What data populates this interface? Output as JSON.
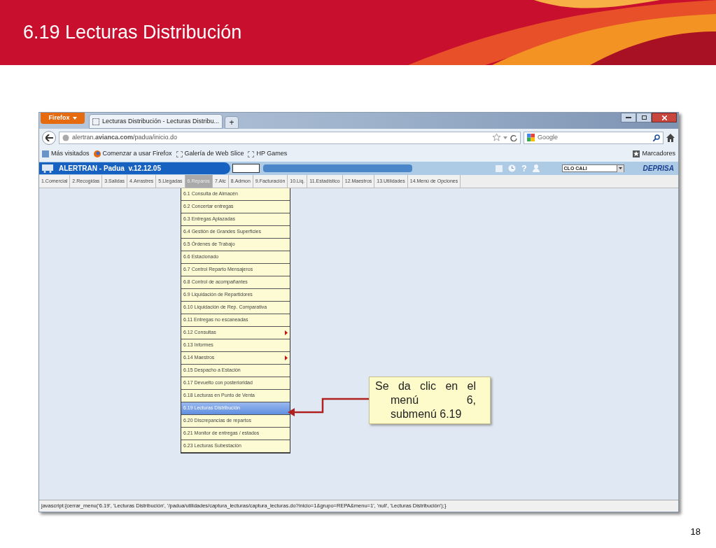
{
  "slide": {
    "title": "6.19 Lecturas Distribución",
    "page_number": "18"
  },
  "browser": {
    "firefox_button": "Firefox",
    "tab_title": "Lecturas Distribución - Lecturas Distribu...",
    "new_tab": "+",
    "url": "alertran.**avianca.com**/padua/inicio.do",
    "search_placeholder": "Google",
    "bookmarks": [
      "Más visitados",
      "Comenzar a usar Firefox",
      "Galería de Web Slice",
      "HP Games"
    ],
    "bookmarks_menu": "Marcadores"
  },
  "app": {
    "title": "ALERTRAN - Padua  v.12.12.05",
    "help": "?",
    "office": "CLO CALI",
    "logo": "DEPRISA"
  },
  "menu_tabs": [
    {
      "label": "1.Comercial",
      "selected": false
    },
    {
      "label": "2.Recogidas",
      "selected": false
    },
    {
      "label": "3.Salidas",
      "selected": false
    },
    {
      "label": "4.Arrastres",
      "selected": false
    },
    {
      "label": "5.Llegadas",
      "selected": false
    },
    {
      "label": "6.Reparos",
      "selected": true
    },
    {
      "label": "7.Atc",
      "selected": false
    },
    {
      "label": "8.Admon",
      "selected": false
    },
    {
      "label": "9.Facturación",
      "selected": false
    },
    {
      "label": "10.Liq.",
      "selected": false
    },
    {
      "label": "11.Estadístico",
      "selected": false
    },
    {
      "label": "12.Maestros",
      "selected": false
    },
    {
      "label": "13.Utilidades",
      "selected": false
    },
    {
      "label": "14.Menú de Opciones",
      "selected": false
    }
  ],
  "submenu": [
    {
      "label": "6.1 Consulta de Almacén",
      "kind": "item",
      "selected": false
    },
    {
      "label": "6.2 Concertar entregas",
      "kind": "item",
      "selected": false
    },
    {
      "label": "6.3 Entregas Aplazadas",
      "kind": "item",
      "selected": false
    },
    {
      "label": "6.4 Gestión de Grandes Superficies",
      "kind": "item",
      "selected": false
    },
    {
      "label": "6.5 Órdenes de Trabajo",
      "kind": "item",
      "selected": false
    },
    {
      "label": "6.6 Estacionado",
      "kind": "item",
      "selected": false
    },
    {
      "label": "6.7 Control Reparto Mensajeros",
      "kind": "item",
      "selected": false
    },
    {
      "label": "6.8 Control de acompañantes",
      "kind": "item",
      "selected": false
    },
    {
      "label": "6.9 Liquidación de Repartidores",
      "kind": "item",
      "selected": false
    },
    {
      "label": "6.10 Liquidación de Rep. Comparativa",
      "kind": "item",
      "selected": false
    },
    {
      "label": "6.11 Entregas no escaneadas",
      "kind": "item",
      "selected": false
    },
    {
      "label": "6.12 Consultas",
      "kind": "submenu",
      "selected": false
    },
    {
      "label": "6.13 Informes",
      "kind": "item",
      "selected": false
    },
    {
      "label": "6.14 Maestros",
      "kind": "submenu",
      "selected": false
    },
    {
      "label": "6.15 Despacho a Estación",
      "kind": "item",
      "selected": false
    },
    {
      "label": "6.17 Devuelto con posterioridad",
      "kind": "item",
      "selected": false
    },
    {
      "label": "6.18 Lecturas en Punto de Venta",
      "kind": "item",
      "selected": false
    },
    {
      "label": "6.19 Lecturas Distribución",
      "kind": "item",
      "selected": true
    },
    {
      "label": "6.20 Discrepancias de repartos",
      "kind": "item",
      "selected": false
    },
    {
      "label": "6.21 Monitor de entregas / estados",
      "kind": "item",
      "selected": false
    },
    {
      "label": "6.23 Lecturas Subestación",
      "kind": "item",
      "selected": false
    }
  ],
  "status_bar": "javascript:{cerrar_menu('6.19', 'Lecturas Distribución', '/padua/utilidades/captura_lecturas/captura_lecturas.do?inicio=1&grupo=REPA&menu=1', 'null', 'Lecturas Distribución');}",
  "callout": "Se da clic en el menú 6, submenú 6.19"
}
